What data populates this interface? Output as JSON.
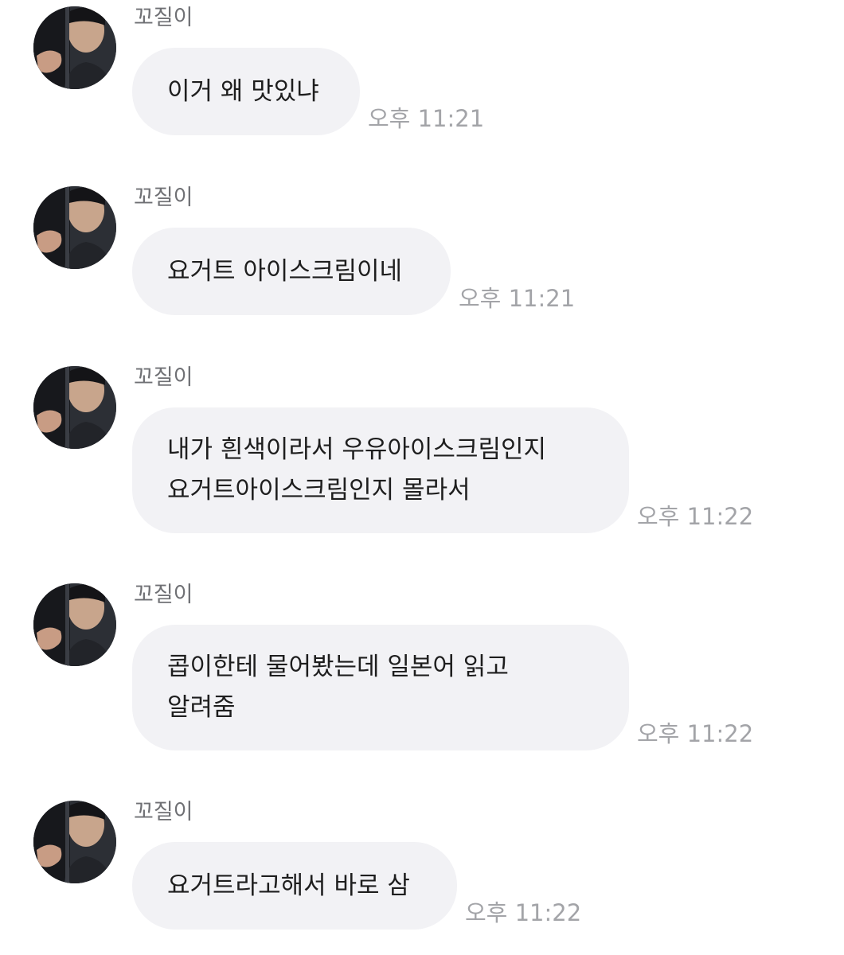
{
  "chat": {
    "messages": [
      {
        "sender": "꼬질이",
        "lines": [
          "이거 왜 맛있냐"
        ],
        "time": "오후 11:21",
        "avatar_icon": "profile-photo-icon"
      },
      {
        "sender": "꼬질이",
        "lines": [
          "요거트 아이스크림이네"
        ],
        "time": "오후 11:21",
        "avatar_icon": "profile-photo-icon"
      },
      {
        "sender": "꼬질이",
        "lines": [
          "내가 흰색이라서 우유아이스크림인지",
          "요거트아이스크림인지 몰라서"
        ],
        "time": "오후 11:22",
        "avatar_icon": "profile-photo-icon"
      },
      {
        "sender": "꼬질이",
        "lines": [
          "콥이한테 물어봤는데 일본어 읽고",
          "알려줌"
        ],
        "time": "오후 11:22",
        "avatar_icon": "profile-photo-icon"
      },
      {
        "sender": "꼬질이",
        "lines": [
          "요거트라고해서 바로 삼"
        ],
        "time": "오후 11:22",
        "avatar_icon": "profile-photo-icon"
      }
    ]
  },
  "colors": {
    "bubble_bg": "#f2f2f5",
    "sender_text": "#6f7074",
    "message_text": "#1e1e1e",
    "timestamp_text": "#a3a4a8"
  }
}
